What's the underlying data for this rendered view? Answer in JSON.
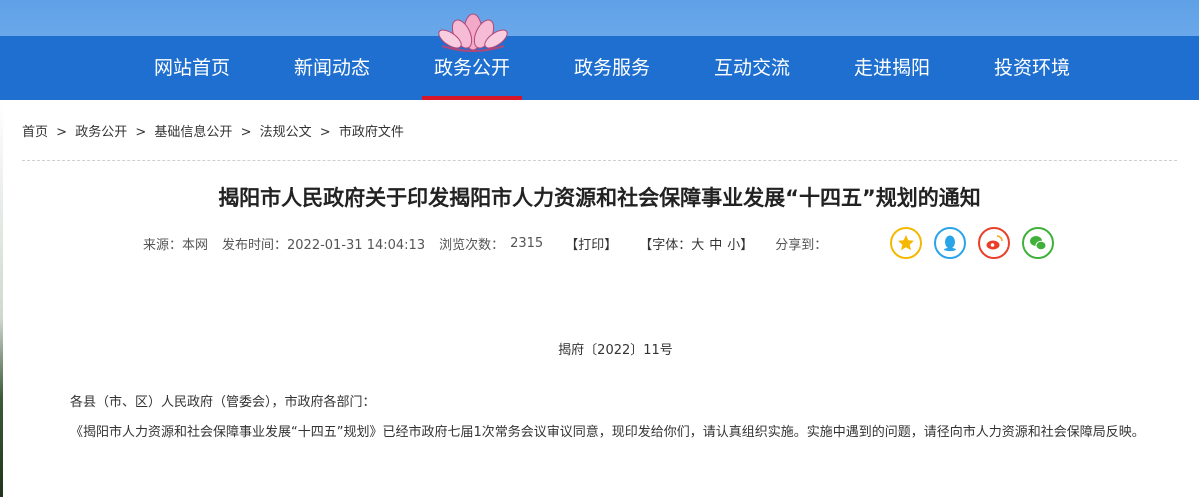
{
  "nav": {
    "items": [
      "网站首页",
      "新闻动态",
      "政务公开",
      "政务服务",
      "互动交流",
      "走进揭阳",
      "投资环境"
    ],
    "active_index": 2,
    "bg_color": "#1f6fd0",
    "active_color": "#d7162a"
  },
  "breadcrumb": [
    "首页",
    ">",
    "政务公开",
    ">",
    "基础信息公开",
    ">",
    "法规公文",
    ">",
    "市政府文件"
  ],
  "article": {
    "title": "揭阳市人民政府关于印发揭阳市人力资源和社会保障事业发展“十四五”规划的通知",
    "source": "来源：本网",
    "published": "发布时间：2022-01-31 14:04:13",
    "views_label": "浏览次数：",
    "views": "2315",
    "print": "【打印】",
    "font_label": "【字体：",
    "font_large": "大",
    "font_medium": "中",
    "font_small": "小",
    "font_close": "】",
    "share_label": "分享到：",
    "share_icons": [
      "favorite-icon",
      "qq-icon",
      "weibo-icon",
      "wechat-icon"
    ],
    "doc_number": "揭府〔2022〕11号",
    "salutation": "各县（市、区）人民政府（管委会），市政府各部门：",
    "body": "《揭阳市人力资源和社会保障事业发展“十四五”规划》已经市政府七届1次常务会议审议同意，现印发给你们，请认真组织实施。实施中遇到的问题，请径向市人力资源和社会保障局反映。"
  }
}
